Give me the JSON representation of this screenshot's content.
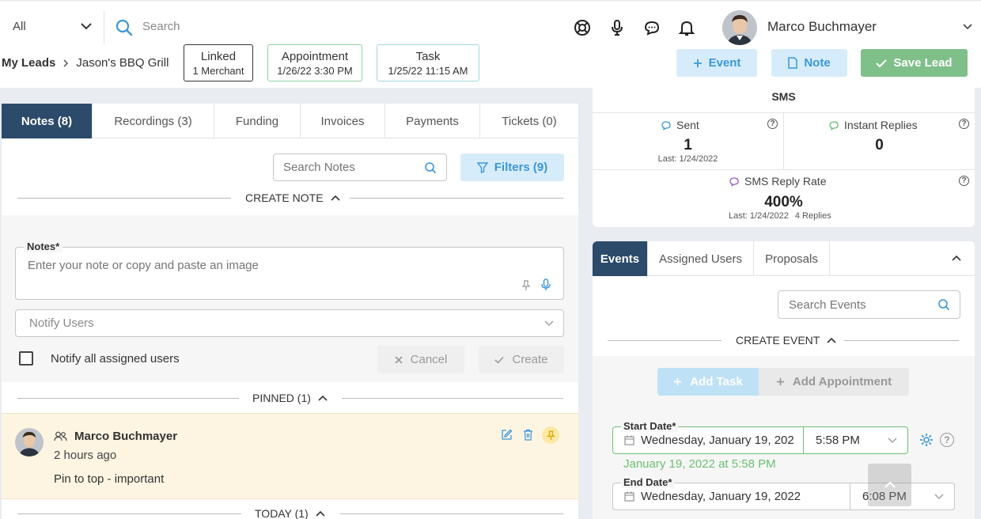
{
  "topbar": {
    "scope": "All",
    "search_placeholder": "Search",
    "user_name": "Marco Buchmayer"
  },
  "breadcrumb": {
    "root": "My Leads",
    "current": "Jason's BBQ Grill"
  },
  "chips": [
    {
      "label": "Linked",
      "sub": "1 Merchant"
    },
    {
      "label": "Appointment",
      "sub": "1/26/22 3:30 PM"
    },
    {
      "label": "Task",
      "sub": "1/25/22 11:15 AM"
    }
  ],
  "actions": {
    "event": "Event",
    "note": "Note",
    "save": "Save Lead"
  },
  "left_tabs": [
    "Notes (8)",
    "Recordings (3)",
    "Funding",
    "Invoices",
    "Payments",
    "Tickets (0)"
  ],
  "notes": {
    "search_placeholder": "Search Notes",
    "filters": "Filters (9)",
    "create_title": "CREATE NOTE",
    "notes_label": "Notes*",
    "notes_placeholder": "Enter your note or copy and paste an image",
    "notify_placeholder": "Notify Users",
    "notify_all": "Notify all assigned users",
    "cancel": "Cancel",
    "create": "Create",
    "pinned_title": "PINNED (1)",
    "today_title": "TODAY (1)"
  },
  "pinned_note": {
    "author": "Marco Buchmayer",
    "time": "2 hours ago",
    "text": "Pin to top - important"
  },
  "sms": {
    "title": "SMS",
    "sent_label": "Sent",
    "sent_value": "1",
    "sent_last": "Last: 1/24/2022",
    "instant_label": "Instant Replies",
    "instant_value": "0",
    "rate_label": "SMS Reply Rate",
    "rate_value": "400%",
    "rate_last": "Last: 1/24/2022",
    "rate_replies": "4 Replies"
  },
  "right_tabs": [
    "Events",
    "Assigned Users",
    "Proposals"
  ],
  "events": {
    "search_placeholder": "Search Events",
    "create_title": "CREATE EVENT",
    "add_task": "Add Task",
    "add_appointment": "Add Appointment",
    "start_label": "Start Date*",
    "start_date": "Wednesday, January 19, 202",
    "start_time": "5:58 PM",
    "start_hint": "January 19, 2022 at 5:58 PM",
    "end_label": "End Date*",
    "end_date": "Wednesday, January 19, 2022",
    "end_time": "6:08 PM"
  },
  "colors": {
    "navy": "#2c4a6a",
    "light_blue": "#d6ecfa",
    "blue_text": "#3b96d8",
    "green": "#7fbf8a",
    "pinned_bg": "#fdf5e2",
    "hint_green": "#6cbf72"
  }
}
